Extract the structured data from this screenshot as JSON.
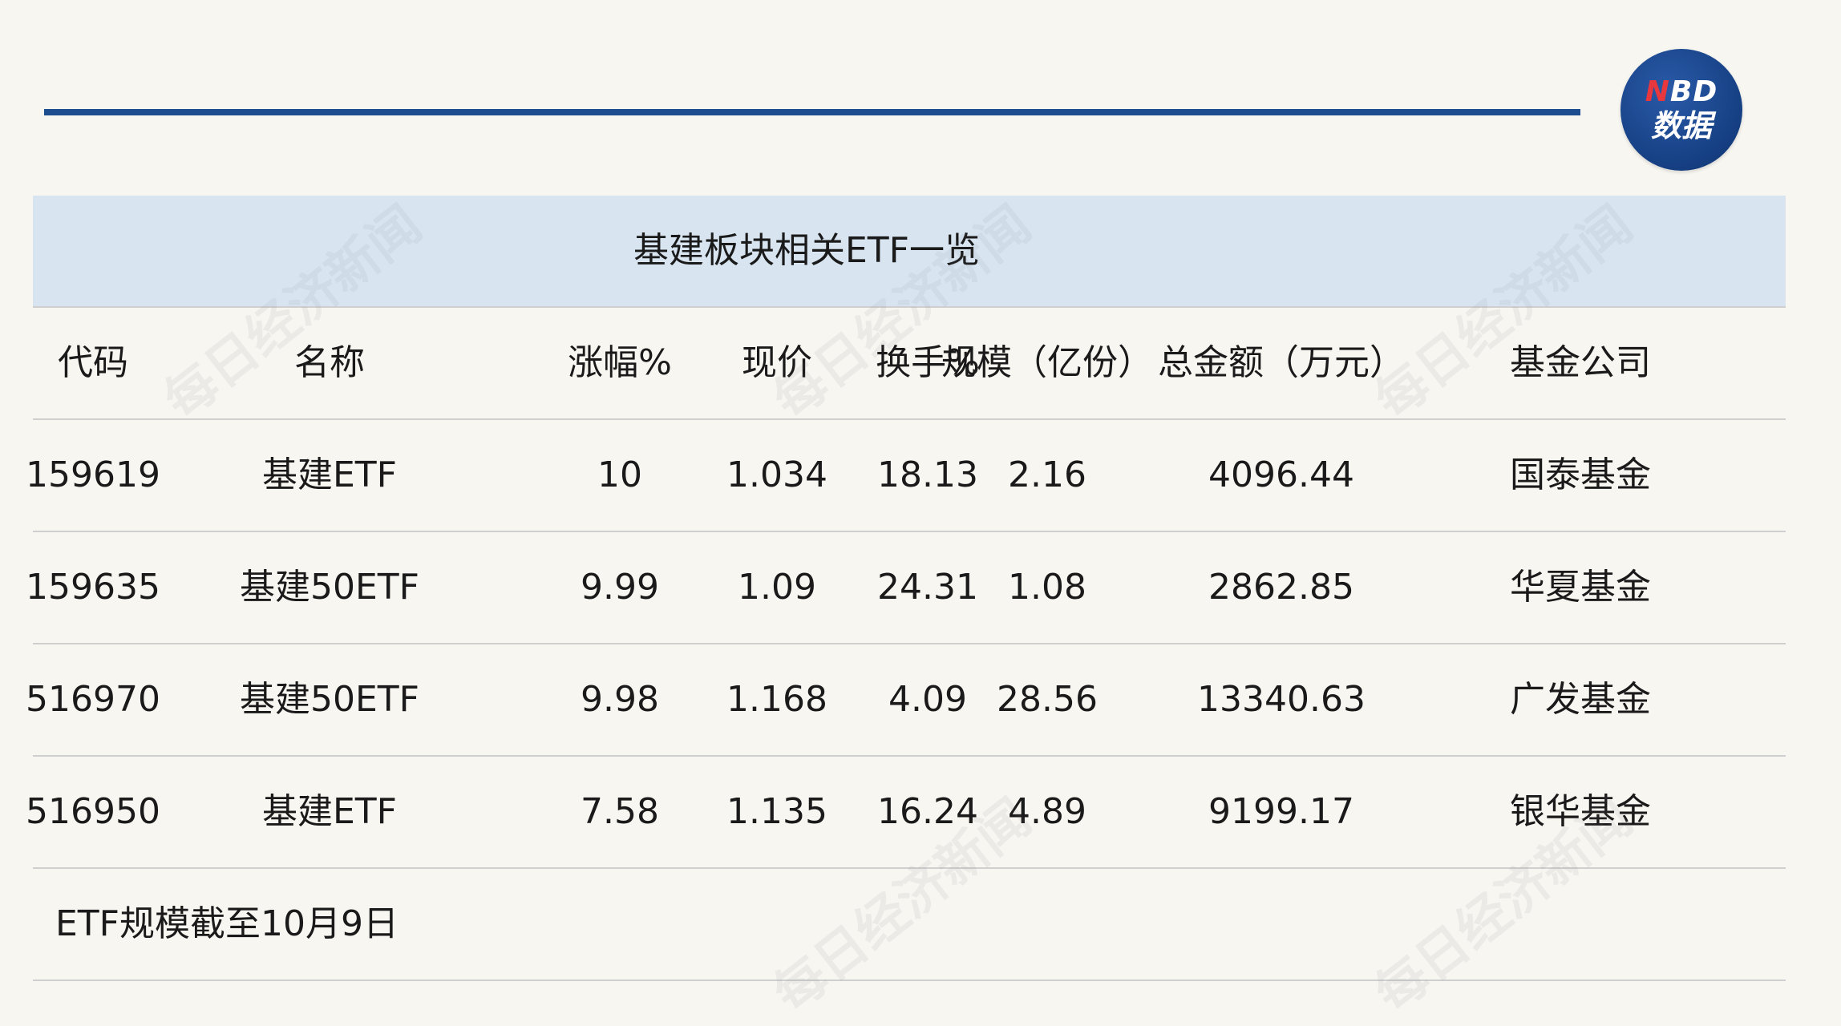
{
  "logo": {
    "line1_accent": "N",
    "line1_rest": "BD",
    "line2": "数据"
  },
  "title": "基建板块相关ETF一览",
  "headers": [
    "代码",
    "名称",
    "涨幅%",
    "现价",
    "换手%",
    "规模（亿份）",
    "总金额（万元）",
    "基金公司"
  ],
  "rows": [
    [
      "159619",
      "基建ETF",
      "10",
      "1.034",
      "18.13",
      "2.16",
      "4096.44",
      "国泰基金"
    ],
    [
      "159635",
      "基建50ETF",
      "9.99",
      "1.09",
      "24.31",
      "1.08",
      "2862.85",
      "华夏基金"
    ],
    [
      "516970",
      "基建50ETF",
      "9.98",
      "1.168",
      "4.09",
      "28.56",
      "13340.63",
      "广发基金"
    ],
    [
      "516950",
      "基建ETF",
      "7.58",
      "1.135",
      "16.24",
      "4.89",
      "9199.17",
      "银华基金"
    ]
  ],
  "note": "ETF规模截至10月9日",
  "watermark": "每日经济新闻",
  "colors": {
    "rule": "#1e4d8f",
    "title_band": "#d8e5f1",
    "background": "#f8f6f1"
  }
}
